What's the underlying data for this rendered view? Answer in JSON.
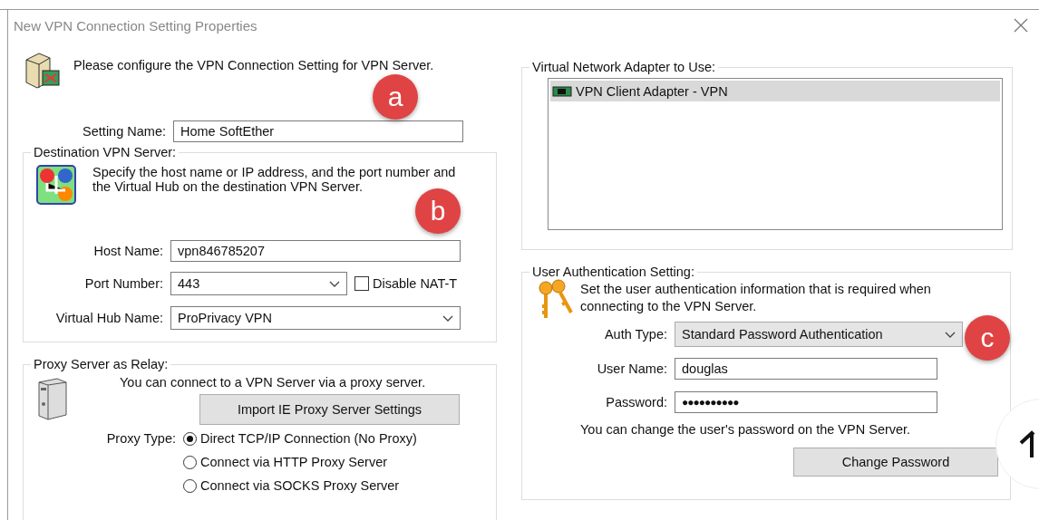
{
  "window": {
    "title": "New VPN Connection Setting Properties"
  },
  "intro": {
    "text": "Please configure the VPN Connection Setting for VPN Server."
  },
  "setting_name": {
    "label": "Setting Name:",
    "value": "Home SoftEther"
  },
  "destination": {
    "title": "Destination VPN Server:",
    "description": "Specify the host name or IP address, and the port number and the Virtual Hub on the destination VPN Server.",
    "host_name": {
      "label": "Host Name:",
      "value": "vpn846785207"
    },
    "port": {
      "label": "Port Number:",
      "value": "443"
    },
    "disable_nat_t": {
      "label": "Disable NAT-T",
      "checked": false
    },
    "hub": {
      "label": "Virtual Hub Name:",
      "value": "ProPrivacy VPN"
    }
  },
  "proxy": {
    "title": "Proxy Server as Relay:",
    "description": "You can connect to a VPN Server via a proxy server.",
    "import_button": "Import IE Proxy Server Settings",
    "type_label": "Proxy Type:",
    "options": [
      {
        "label": "Direct TCP/IP Connection (No Proxy)",
        "selected": true
      },
      {
        "label": "Connect via HTTP Proxy Server",
        "selected": false
      },
      {
        "label": "Connect via SOCKS Proxy Server",
        "selected": false
      }
    ]
  },
  "adapter": {
    "title": "Virtual Network Adapter to Use:",
    "items": [
      {
        "label": "VPN Client Adapter - VPN",
        "selected": true
      }
    ]
  },
  "auth": {
    "title": "User Authentication Setting:",
    "description": "Set the user authentication information that is required when connecting to the VPN Server.",
    "auth_type": {
      "label": "Auth Type:",
      "value": "Standard Password Authentication"
    },
    "user_name": {
      "label": "User Name:",
      "value": "douglas"
    },
    "password": {
      "label": "Password:",
      "value": "●●●●●●●●●●"
    },
    "note": "You can change the user's password on the VPN Server.",
    "change_button": "Change Password"
  },
  "callouts": [
    {
      "label": "a"
    },
    {
      "label": "b"
    },
    {
      "label": "c"
    }
  ]
}
